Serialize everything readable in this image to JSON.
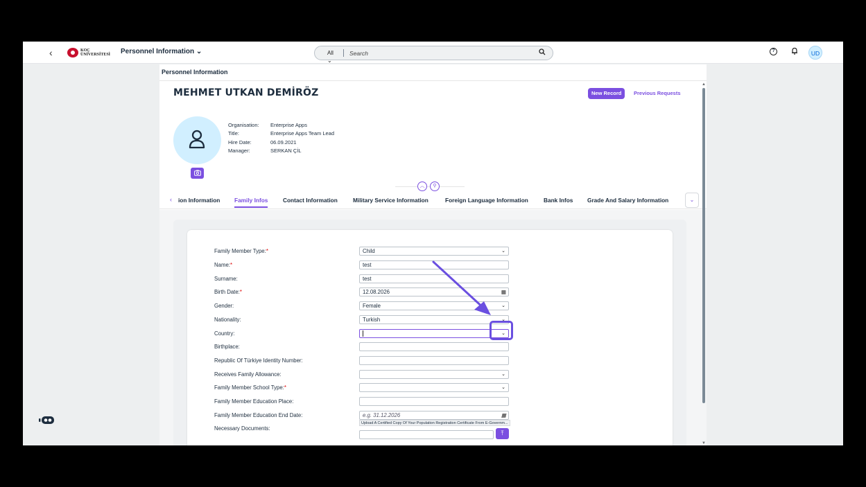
{
  "shell": {
    "back_icon": "chevron-left-icon",
    "logo_text_line1": "KOÇ",
    "logo_text_line2": "ÜNİVERSİTESİ",
    "app_title": "Personnel Information ⌄",
    "search_scope": "All",
    "search_placeholder": "Search",
    "avatar_initials": "UD"
  },
  "page": {
    "breadcrumb": "Personnel Information",
    "employee_name": "MEHMET UTKAN DEMİRÖZ",
    "new_record_label": "New Record",
    "previous_requests_label": "Previous Requests",
    "info": [
      {
        "key": "Organisation:",
        "value": "Enterprise Apps"
      },
      {
        "key": "Title:",
        "value": "Enterprise Apps Team Lead"
      },
      {
        "key": "Hire Date:",
        "value": "06.09.2021"
      },
      {
        "key": "Manager:",
        "value": "SERKAN ÇİL"
      }
    ]
  },
  "tabs": [
    {
      "label": "ion Information",
      "active": false
    },
    {
      "label": "Family Infos",
      "active": true
    },
    {
      "label": "Contact Information",
      "active": false
    },
    {
      "label": "Military Service Information",
      "active": false
    },
    {
      "label": "Foreign Language Information",
      "active": false
    },
    {
      "label": "Bank Infos",
      "active": false
    },
    {
      "label": "Grade And Salary Information",
      "active": false
    }
  ],
  "form": {
    "fields": [
      {
        "label": "Family Member Type:",
        "required": "*",
        "value": "Child",
        "kind": "select"
      },
      {
        "label": "Name:",
        "required": "*",
        "value": "test",
        "kind": "input"
      },
      {
        "label": "Surname:",
        "required": "",
        "value": "test",
        "kind": "input"
      },
      {
        "label": "Birth Date:",
        "required": "*",
        "value": "12.08.2026",
        "kind": "date"
      },
      {
        "label": "Gender:",
        "required": "",
        "value": "Female",
        "kind": "select"
      },
      {
        "label": "Nationality:",
        "required": "",
        "value": "Turkish",
        "kind": "select"
      },
      {
        "label": "Country:",
        "required": "",
        "value": "",
        "kind": "select-focused"
      },
      {
        "label": "Birthplace:",
        "required": "",
        "value": "",
        "kind": "input"
      },
      {
        "label": "Republic Of Türkiye Identity Number:",
        "required": "",
        "value": "",
        "kind": "input"
      },
      {
        "label": "Receives Family Allowance:",
        "required": "",
        "value": "",
        "kind": "select"
      },
      {
        "label": "Family Member School Type:",
        "required": "*",
        "value": "",
        "kind": "select"
      },
      {
        "label": "Family Member Education Place:",
        "required": "",
        "value": "",
        "kind": "input"
      },
      {
        "label": "Family Member Education End Date:",
        "required": "",
        "value": "",
        "placeholder": "e.g. 31.12.2026",
        "kind": "date"
      }
    ],
    "necessary_documents_label": "Necessary Documents:",
    "upload_note": "Upload A Certified Copy Of Your Population Registration Certificate From E-Governm..."
  },
  "colors": {
    "accent": "#7b4fe0",
    "annotation": "#6a4fe0"
  }
}
